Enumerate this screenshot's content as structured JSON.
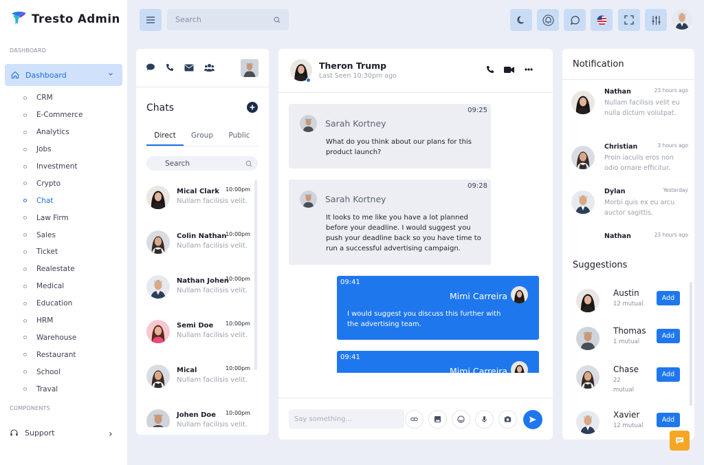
{
  "brand": {
    "name": "Tresto Admin"
  },
  "colors": {
    "accent": "#1f77ee",
    "sidebar_active": "#cfe1fb",
    "topbar_button": "#c8dcf6",
    "fab": "#f5a623"
  },
  "sidebar": {
    "section_label": "DASHBOARD",
    "dashboard_label": "Dashboard",
    "items": [
      {
        "label": "CRM"
      },
      {
        "label": "E-Commerce"
      },
      {
        "label": "Analytics"
      },
      {
        "label": "Jobs"
      },
      {
        "label": "Investment"
      },
      {
        "label": "Crypto"
      },
      {
        "label": "Chat",
        "active": true
      },
      {
        "label": "Law Firm"
      },
      {
        "label": "Sales"
      },
      {
        "label": "Ticket"
      },
      {
        "label": "Realestate"
      },
      {
        "label": "Medical"
      },
      {
        "label": "Education"
      },
      {
        "label": "HRM"
      },
      {
        "label": "Warehouse"
      },
      {
        "label": "Restaurant"
      },
      {
        "label": "School"
      },
      {
        "label": "Traval"
      }
    ],
    "components_label": "COMPONENTS",
    "support_label": "Support"
  },
  "topbar": {
    "search_placeholder": "Search",
    "icons": [
      "moon-icon",
      "bell-icon",
      "message-icon",
      "us-flag-icon",
      "fullscreen-icon",
      "sliders-icon"
    ]
  },
  "chats": {
    "title": "Chats",
    "tabs": [
      {
        "label": "Direct",
        "active": true
      },
      {
        "label": "Group"
      },
      {
        "label": "Public"
      }
    ],
    "search_placeholder": "Search",
    "contacts": [
      {
        "name": "Mical Clark",
        "time": "10:00pm",
        "message": "Nullam facilisis velit."
      },
      {
        "name": "Colin Nathan",
        "time": "10:00pm",
        "message": "Nullam facilisis velit."
      },
      {
        "name": "Nathan Johen",
        "time": "10:00pm",
        "message": "Nullam facilisis velit."
      },
      {
        "name": "Semi Doe",
        "time": "10:00pm",
        "message": "Nullam facilisis velit."
      },
      {
        "name": "Mical",
        "time": "10:00pm",
        "message": "Nullam facilisis velit."
      },
      {
        "name": "Johen Doe",
        "time": "10:00pm",
        "message": "Nullam facilisis velit."
      }
    ]
  },
  "conversation": {
    "contact_name": "Theron Trump",
    "last_seen": "Last Seen 10:30pm ago",
    "messages": [
      {
        "sender": "Sarah Kortney",
        "time": "09:25",
        "text": "What do you think about our plans for this product launch?",
        "direction": "in"
      },
      {
        "sender": "Sarah Kortney",
        "time": "09:28",
        "text": "It looks to me like you have a lot planned before your deadline. I would suggest you push your deadline back so you have time to run a successful advertising campaign.",
        "direction": "in"
      },
      {
        "sender": "Mimi Carreira",
        "time": "09:41",
        "text": "I would suggest you discuss this further with the advertising team.",
        "direction": "out"
      },
      {
        "sender": "Mimi Carreira",
        "time": "09:41",
        "text": "",
        "direction": "out"
      }
    ],
    "input_placeholder": "Say something..."
  },
  "notifications": {
    "title": "Notification",
    "items": [
      {
        "name": "Nathan",
        "time": "23 hours ago",
        "text": "Nullam facilisis velit eu nulla dictum volutpat."
      },
      {
        "name": "Christian",
        "time": "3 hours ago",
        "text": "Proin iaculis eros non odio ornare efficitur."
      },
      {
        "name": "Dylan",
        "time": "Yesterday",
        "text": "Morbi quis ex eu arcu auctor sagittis."
      },
      {
        "name": "Nathan",
        "time": "23 hours ago",
        "text": ""
      }
    ]
  },
  "suggestions": {
    "title": "Suggestions",
    "add_label": "Add",
    "items": [
      {
        "name": "Austin",
        "mutual": "12 mutual"
      },
      {
        "name": "Thomas",
        "mutual": "1 mutual"
      },
      {
        "name": "Chase",
        "mutual": "22 mutual"
      },
      {
        "name": "Xavier",
        "mutual": "12 mutual"
      }
    ]
  }
}
